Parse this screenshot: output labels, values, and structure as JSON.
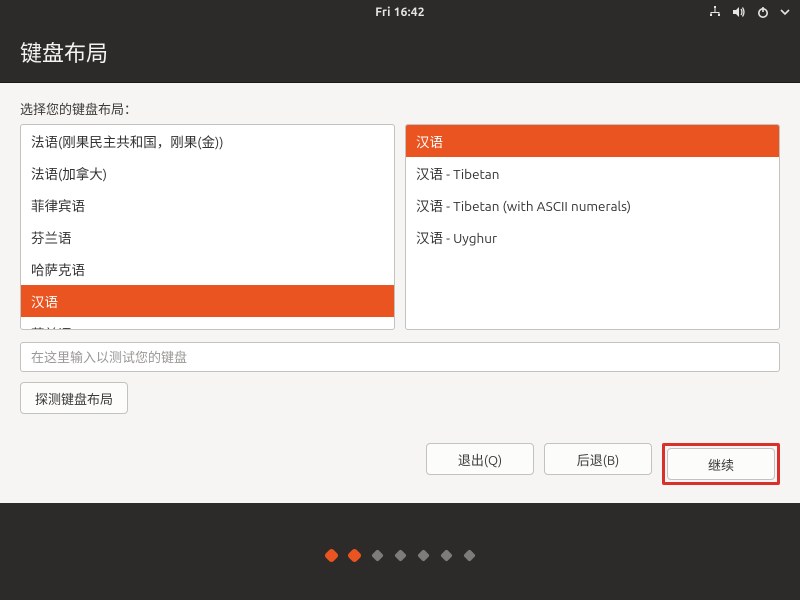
{
  "menubar": {
    "clock": "Fri 16:42",
    "icons": {
      "network": "network-icon",
      "volume": "volume-icon",
      "power": "power-icon",
      "chevron": "chevron-down-icon"
    }
  },
  "header": {
    "title": "键盘布局"
  },
  "prompt": "选择您的键盘布局：",
  "left_list": [
    {
      "label": "法语(刚果民主共和国，刚果(金))",
      "selected": false
    },
    {
      "label": "法语(加拿大)",
      "selected": false
    },
    {
      "label": "菲律宾语",
      "selected": false
    },
    {
      "label": "芬兰语",
      "selected": false
    },
    {
      "label": "哈萨克语",
      "selected": false
    },
    {
      "label": "汉语",
      "selected": true
    },
    {
      "label": "荷兰语",
      "selected": false
    }
  ],
  "right_list": [
    {
      "label": "汉语",
      "selected": true
    },
    {
      "label": "汉语 - Tibetan",
      "selected": false
    },
    {
      "label": "汉语 - Tibetan (with ASCII numerals)",
      "selected": false
    },
    {
      "label": "汉语 - Uyghur",
      "selected": false
    }
  ],
  "test_input": {
    "placeholder": "在这里输入以测试您的键盘",
    "value": ""
  },
  "detect_button": "探测键盘布局",
  "nav": {
    "quit": "退出(Q)",
    "back": "后退(B)",
    "continue": "继续"
  },
  "steps": {
    "total": 7,
    "active_indices": [
      0,
      1
    ]
  },
  "colors": {
    "accent": "#e95420",
    "highlight_border": "#d9302c",
    "dark_bg": "#2c2b2a",
    "surface_bg": "#f6f5f4"
  }
}
